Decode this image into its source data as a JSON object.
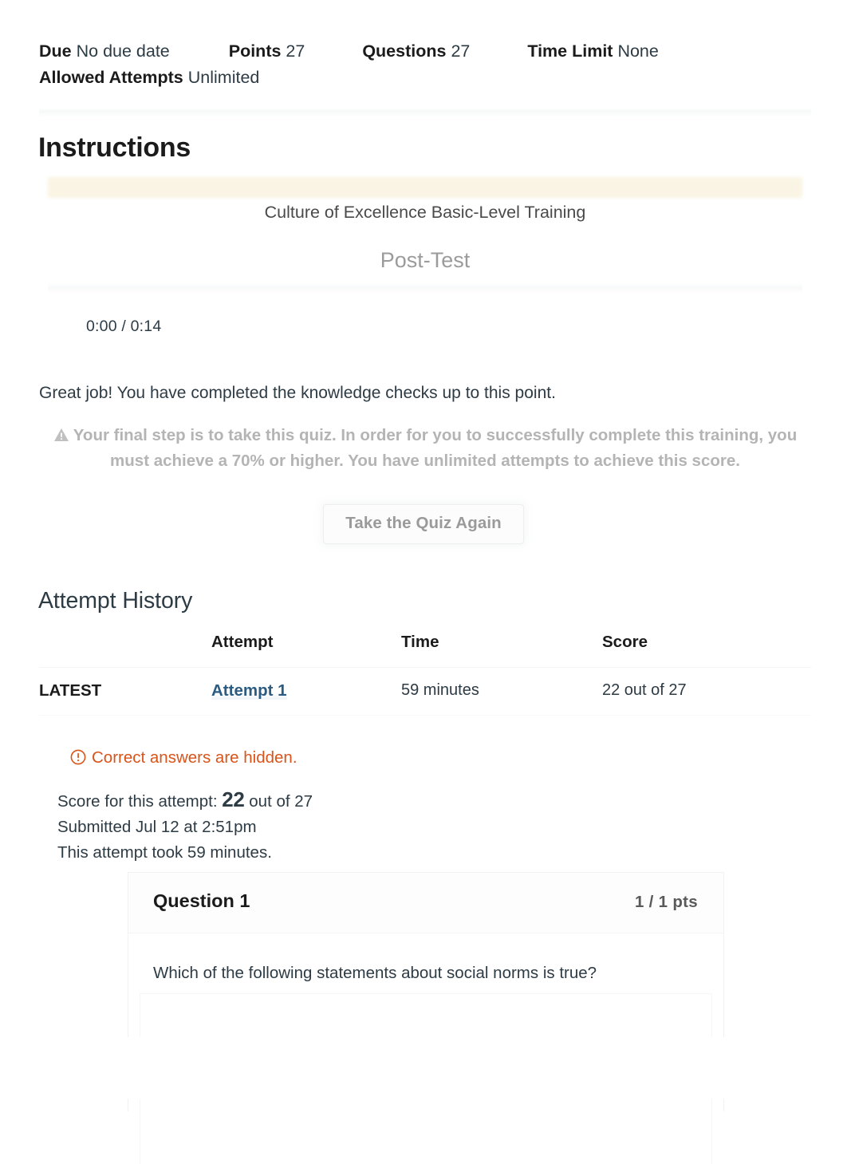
{
  "meta": {
    "due_label": "Due",
    "due_value": "No due date",
    "points_label": "Points",
    "points_value": "27",
    "questions_label": "Questions",
    "questions_value": "27",
    "time_limit_label": "Time Limit",
    "time_limit_value": "None",
    "allowed_attempts_label": "Allowed Attempts",
    "allowed_attempts_value": "Unlimited"
  },
  "instructions": {
    "heading": "Instructions",
    "course_title": "Culture of Excellence Basic-Level Training",
    "subtitle": "Post-Test"
  },
  "media": {
    "time_display": "0:00 / 0:14",
    "current_time": "0:00",
    "duration": "0:14"
  },
  "body": {
    "great_job": "Great job! You have completed the knowledge checks up to this point.",
    "warning_text": "Your final step is to take this quiz. In order for you to successfully complete this training, you must achieve a 70% or higher. You have unlimited attempts to achieve this score.",
    "warning_icon": "warning-triangle-icon"
  },
  "actions": {
    "retake_label": "Take the Quiz Again"
  },
  "attempt_history": {
    "heading": "Attempt History",
    "columns": [
      "",
      "Attempt",
      "Time",
      "Score"
    ],
    "rows": [
      {
        "latest": "LATEST",
        "attempt": "Attempt 1",
        "time": "59 minutes",
        "score": "22 out of 27"
      }
    ]
  },
  "notice": {
    "icon": "circle-exclamation-icon",
    "text": "Correct answers are hidden.",
    "color": "#d9541a"
  },
  "score_summary": {
    "score_prefix": "Score for this attempt:",
    "score_value": "22",
    "score_suffix": "out of 27",
    "submitted": "Submitted Jul 12 at 2:51pm",
    "duration": "This attempt took 59 minutes."
  },
  "question": {
    "title": "Question 1",
    "points": "1 / 1 pts",
    "text": "Which of the following statements about social norms is true?"
  },
  "colors": {
    "link": "#2b5b80",
    "notice_orange": "#d9541a",
    "ivory_band": "#f9f4e2",
    "text": "#2d3b45",
    "muted": "#9b9b9b"
  }
}
